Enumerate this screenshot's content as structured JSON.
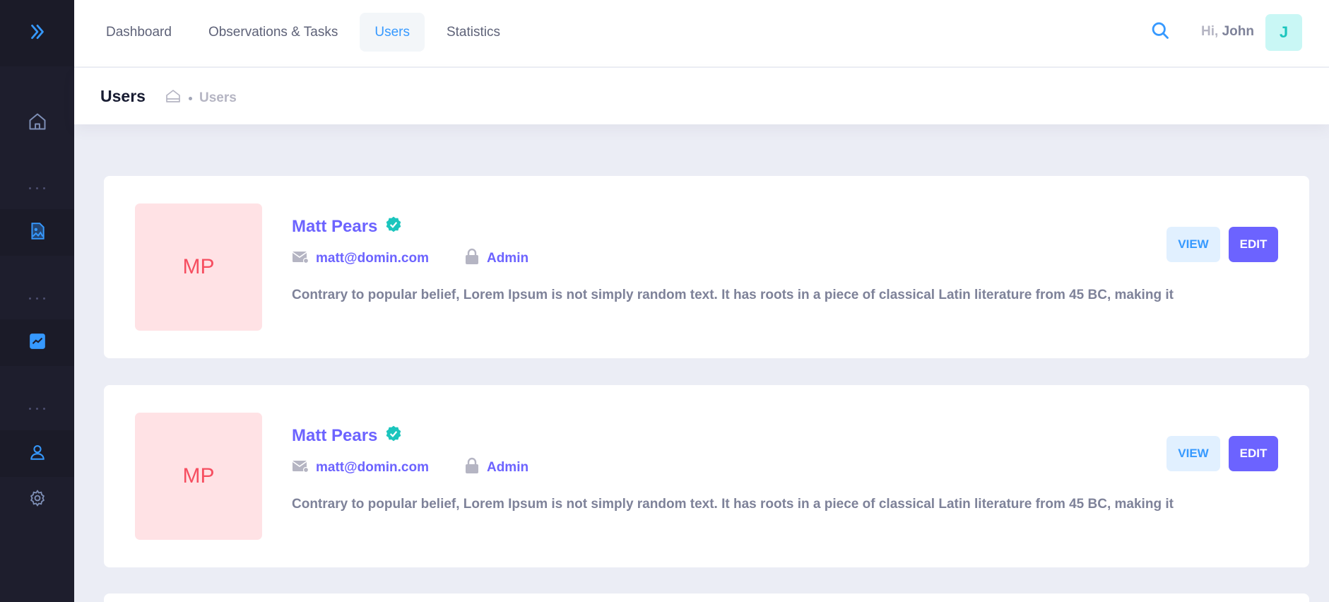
{
  "nav": {
    "items": [
      {
        "label": "Dashboard"
      },
      {
        "label": "Observations & Tasks"
      },
      {
        "label": "Users"
      },
      {
        "label": "Statistics"
      }
    ],
    "active": "Users"
  },
  "user": {
    "greeting": "Hi,",
    "name": "John",
    "initial": "J"
  },
  "subheader": {
    "title": "Users",
    "breadcrumb": "Users"
  },
  "sidebar": {
    "icons": [
      "expand-arrows-icon",
      "home-icon",
      "file-image-icon",
      "chart-icon",
      "user-icon",
      "gear-icon"
    ],
    "active": "user-icon"
  },
  "users": [
    {
      "initials": "MP",
      "name": "Matt Pears",
      "email": "matt@domin.com",
      "role": "Admin",
      "description": "Contrary to popular belief, Lorem Ipsum is not simply random text. It has roots in a piece of classical Latin literature from 45 BC, making it",
      "view_label": "VIEW",
      "edit_label": "EDIT"
    },
    {
      "initials": "MP",
      "name": "Matt Pears",
      "email": "matt@domin.com",
      "role": "Admin",
      "description": "Contrary to popular belief, Lorem Ipsum is not simply random text. It has roots in a piece of classical Latin literature from 45 BC, making it",
      "view_label": "VIEW",
      "edit_label": "EDIT"
    }
  ],
  "colors": {
    "sidebar_bg": "#1e1e2d",
    "primary": "#3699ff",
    "accent": "#6c63ff",
    "avatar_bg": "#ffe2e5",
    "avatar_text": "#f64e60",
    "verified": "#1bc5bd"
  }
}
